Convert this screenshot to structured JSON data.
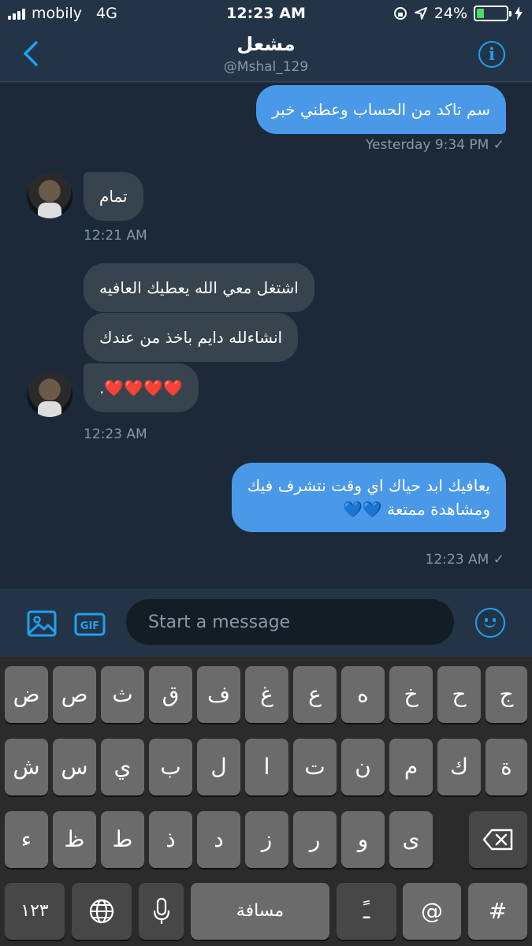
{
  "status_bar": {
    "carrier": "mobily",
    "network": "4G",
    "time": "12:23 AM",
    "battery": "24%",
    "battery_level": 0.24
  },
  "header": {
    "title": "مشعل",
    "handle": "@Mshal_129"
  },
  "messages": [
    {
      "direction": "outgoing",
      "text": "سم تاكد من الحساب وعطني خبر"
    },
    {
      "direction": "meta",
      "text": "Yesterday 9:34 PM ✓"
    },
    {
      "direction": "incoming",
      "text": "تمام"
    },
    {
      "direction": "meta",
      "text": "12:21 AM"
    },
    {
      "direction": "incoming",
      "text": "اشتغل معي الله يعطيك العافيه"
    },
    {
      "direction": "incoming",
      "text": "انشاءلله دايم باخذ من عندك"
    },
    {
      "direction": "incoming",
      "text": "❤️❤️❤️❤️."
    },
    {
      "direction": "meta",
      "text": "12:23 AM"
    },
    {
      "direction": "outgoing",
      "text": "يعافيك ابد حياك اي وقت نتشرف فيك"
    },
    {
      "direction": "outgoing",
      "text": "ومشاهدة ممتعة 💙💙"
    },
    {
      "direction": "meta",
      "text": "12:23 AM ✓"
    }
  ],
  "compose": {
    "placeholder": "Start a message",
    "gif_label": "GIF"
  },
  "keyboard": {
    "row1": [
      "ض",
      "ص",
      "ث",
      "ق",
      "ف",
      "غ",
      "ع",
      "ه",
      "خ",
      "ح",
      "ج"
    ],
    "row2": [
      "ش",
      "س",
      "ي",
      "ب",
      "ل",
      "ا",
      "ت",
      "ن",
      "م",
      "ك",
      "ة"
    ],
    "row3": [
      "ء",
      "ظ",
      "ط",
      "ذ",
      "د",
      "ز",
      "ر",
      "و",
      "ى"
    ],
    "numbers": "١٢٣",
    "space": "مسافة",
    "diacritic": "ـً",
    "at": "@",
    "hash": "#"
  },
  "colors": {
    "accent": "#1da1f2",
    "outgoing_bubble": "#4a99e9",
    "incoming_bubble": "#38444d",
    "background": "#1c2938"
  }
}
